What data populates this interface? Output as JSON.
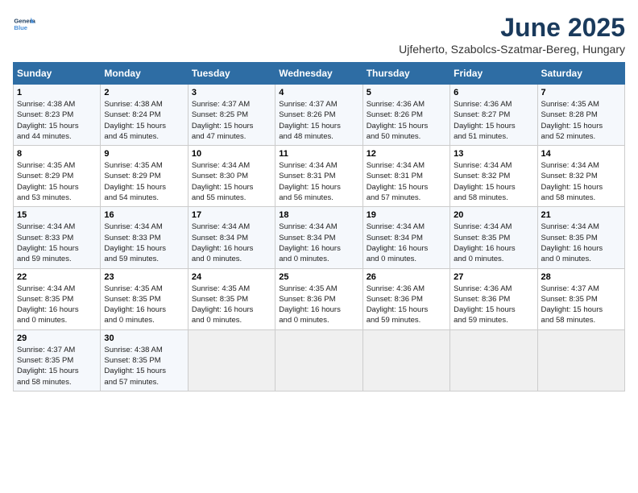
{
  "logo": {
    "line1": "General",
    "line2": "Blue"
  },
  "title": "June 2025",
  "subtitle": "Ujfeherto, Szabolcs-Szatmar-Bereg, Hungary",
  "headers": [
    "Sunday",
    "Monday",
    "Tuesday",
    "Wednesday",
    "Thursday",
    "Friday",
    "Saturday"
  ],
  "weeks": [
    [
      {
        "day": "1",
        "detail": "Sunrise: 4:38 AM\nSunset: 8:23 PM\nDaylight: 15 hours\nand 44 minutes."
      },
      {
        "day": "2",
        "detail": "Sunrise: 4:38 AM\nSunset: 8:24 PM\nDaylight: 15 hours\nand 45 minutes."
      },
      {
        "day": "3",
        "detail": "Sunrise: 4:37 AM\nSunset: 8:25 PM\nDaylight: 15 hours\nand 47 minutes."
      },
      {
        "day": "4",
        "detail": "Sunrise: 4:37 AM\nSunset: 8:26 PM\nDaylight: 15 hours\nand 48 minutes."
      },
      {
        "day": "5",
        "detail": "Sunrise: 4:36 AM\nSunset: 8:26 PM\nDaylight: 15 hours\nand 50 minutes."
      },
      {
        "day": "6",
        "detail": "Sunrise: 4:36 AM\nSunset: 8:27 PM\nDaylight: 15 hours\nand 51 minutes."
      },
      {
        "day": "7",
        "detail": "Sunrise: 4:35 AM\nSunset: 8:28 PM\nDaylight: 15 hours\nand 52 minutes."
      }
    ],
    [
      {
        "day": "8",
        "detail": "Sunrise: 4:35 AM\nSunset: 8:29 PM\nDaylight: 15 hours\nand 53 minutes."
      },
      {
        "day": "9",
        "detail": "Sunrise: 4:35 AM\nSunset: 8:29 PM\nDaylight: 15 hours\nand 54 minutes."
      },
      {
        "day": "10",
        "detail": "Sunrise: 4:34 AM\nSunset: 8:30 PM\nDaylight: 15 hours\nand 55 minutes."
      },
      {
        "day": "11",
        "detail": "Sunrise: 4:34 AM\nSunset: 8:31 PM\nDaylight: 15 hours\nand 56 minutes."
      },
      {
        "day": "12",
        "detail": "Sunrise: 4:34 AM\nSunset: 8:31 PM\nDaylight: 15 hours\nand 57 minutes."
      },
      {
        "day": "13",
        "detail": "Sunrise: 4:34 AM\nSunset: 8:32 PM\nDaylight: 15 hours\nand 58 minutes."
      },
      {
        "day": "14",
        "detail": "Sunrise: 4:34 AM\nSunset: 8:32 PM\nDaylight: 15 hours\nand 58 minutes."
      }
    ],
    [
      {
        "day": "15",
        "detail": "Sunrise: 4:34 AM\nSunset: 8:33 PM\nDaylight: 15 hours\nand 59 minutes."
      },
      {
        "day": "16",
        "detail": "Sunrise: 4:34 AM\nSunset: 8:33 PM\nDaylight: 15 hours\nand 59 minutes."
      },
      {
        "day": "17",
        "detail": "Sunrise: 4:34 AM\nSunset: 8:34 PM\nDaylight: 16 hours\nand 0 minutes."
      },
      {
        "day": "18",
        "detail": "Sunrise: 4:34 AM\nSunset: 8:34 PM\nDaylight: 16 hours\nand 0 minutes."
      },
      {
        "day": "19",
        "detail": "Sunrise: 4:34 AM\nSunset: 8:34 PM\nDaylight: 16 hours\nand 0 minutes."
      },
      {
        "day": "20",
        "detail": "Sunrise: 4:34 AM\nSunset: 8:35 PM\nDaylight: 16 hours\nand 0 minutes."
      },
      {
        "day": "21",
        "detail": "Sunrise: 4:34 AM\nSunset: 8:35 PM\nDaylight: 16 hours\nand 0 minutes."
      }
    ],
    [
      {
        "day": "22",
        "detail": "Sunrise: 4:34 AM\nSunset: 8:35 PM\nDaylight: 16 hours\nand 0 minutes."
      },
      {
        "day": "23",
        "detail": "Sunrise: 4:35 AM\nSunset: 8:35 PM\nDaylight: 16 hours\nand 0 minutes."
      },
      {
        "day": "24",
        "detail": "Sunrise: 4:35 AM\nSunset: 8:35 PM\nDaylight: 16 hours\nand 0 minutes."
      },
      {
        "day": "25",
        "detail": "Sunrise: 4:35 AM\nSunset: 8:36 PM\nDaylight: 16 hours\nand 0 minutes."
      },
      {
        "day": "26",
        "detail": "Sunrise: 4:36 AM\nSunset: 8:36 PM\nDaylight: 15 hours\nand 59 minutes."
      },
      {
        "day": "27",
        "detail": "Sunrise: 4:36 AM\nSunset: 8:36 PM\nDaylight: 15 hours\nand 59 minutes."
      },
      {
        "day": "28",
        "detail": "Sunrise: 4:37 AM\nSunset: 8:35 PM\nDaylight: 15 hours\nand 58 minutes."
      }
    ],
    [
      {
        "day": "29",
        "detail": "Sunrise: 4:37 AM\nSunset: 8:35 PM\nDaylight: 15 hours\nand 58 minutes."
      },
      {
        "day": "30",
        "detail": "Sunrise: 4:38 AM\nSunset: 8:35 PM\nDaylight: 15 hours\nand 57 minutes."
      },
      {
        "day": "",
        "detail": ""
      },
      {
        "day": "",
        "detail": ""
      },
      {
        "day": "",
        "detail": ""
      },
      {
        "day": "",
        "detail": ""
      },
      {
        "day": "",
        "detail": ""
      }
    ]
  ]
}
